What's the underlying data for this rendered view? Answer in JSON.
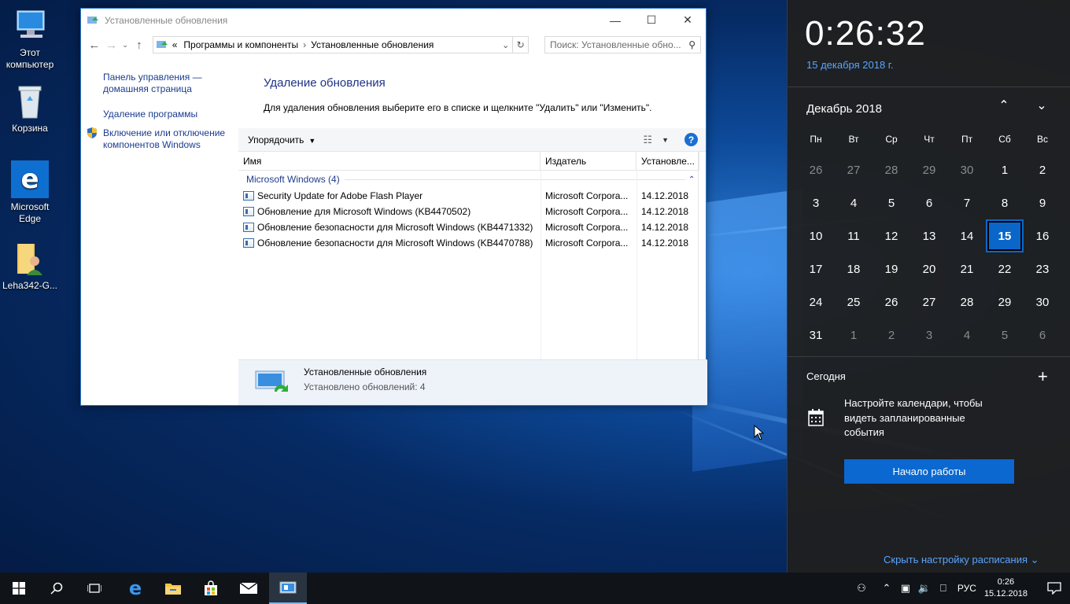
{
  "desktop": {
    "icons": [
      {
        "label": "Этот компьютер",
        "icon": "computer-icon"
      },
      {
        "label": "Корзина",
        "icon": "recycle-bin-icon"
      },
      {
        "label": "Microsoft Edge",
        "icon": "edge-icon"
      },
      {
        "label": "Leha342-G...",
        "icon": "user-folder-icon"
      }
    ]
  },
  "window": {
    "title": "Установленные обновления",
    "address": {
      "prefix": "«",
      "crumb1": "Программы и компоненты",
      "crumb2": "Установленные обновления"
    },
    "search_placeholder": "Поиск: Установленные обно...",
    "left_nav": {
      "home_link": "Панель управления — домашняя страница",
      "uninstall_link": "Удаление программы",
      "features_link": "Включение или отключение компонентов Windows"
    },
    "heading": "Удаление обновления",
    "description": "Для удаления обновления выберите его в списке и щелкните \"Удалить\" или \"Изменить\".",
    "toolbar": {
      "organize": "Упорядочить"
    },
    "columns": {
      "name": "Имя",
      "publisher": "Издатель",
      "installed": "Установле..."
    },
    "group": "Microsoft Windows (4)",
    "rows": [
      {
        "name": "Security Update for Adobe Flash Player",
        "publisher": "Microsoft Corpora...",
        "date": "14.12.2018"
      },
      {
        "name": "Обновление для Microsoft Windows (KB4470502)",
        "publisher": "Microsoft Corpora...",
        "date": "14.12.2018"
      },
      {
        "name": "Обновление безопасности для Microsoft Windows (KB4471332)",
        "publisher": "Microsoft Corpora...",
        "date": "14.12.2018"
      },
      {
        "name": "Обновление безопасности для Microsoft Windows (KB4470788)",
        "publisher": "Microsoft Corpora...",
        "date": "14.12.2018"
      }
    ],
    "details": {
      "title": "Установленные обновления",
      "count": "Установлено обновлений: 4"
    }
  },
  "flyout": {
    "time": "0:26:32",
    "date": "15 декабря 2018 г.",
    "month": "Декабрь 2018",
    "weekdays": [
      "Пн",
      "Вт",
      "Ср",
      "Чт",
      "Пт",
      "Сб",
      "Вс"
    ],
    "weeks": [
      [
        {
          "d": "26",
          "dim": true
        },
        {
          "d": "27",
          "dim": true
        },
        {
          "d": "28",
          "dim": true
        },
        {
          "d": "29",
          "dim": true
        },
        {
          "d": "30",
          "dim": true
        },
        {
          "d": "1"
        },
        {
          "d": "2"
        }
      ],
      [
        {
          "d": "3"
        },
        {
          "d": "4"
        },
        {
          "d": "5"
        },
        {
          "d": "6"
        },
        {
          "d": "7"
        },
        {
          "d": "8"
        },
        {
          "d": "9"
        }
      ],
      [
        {
          "d": "10"
        },
        {
          "d": "11"
        },
        {
          "d": "12"
        },
        {
          "d": "13"
        },
        {
          "d": "14"
        },
        {
          "d": "15",
          "today": true
        },
        {
          "d": "16"
        }
      ],
      [
        {
          "d": "17"
        },
        {
          "d": "18"
        },
        {
          "d": "19"
        },
        {
          "d": "20"
        },
        {
          "d": "21"
        },
        {
          "d": "22"
        },
        {
          "d": "23"
        }
      ],
      [
        {
          "d": "24"
        },
        {
          "d": "25"
        },
        {
          "d": "26"
        },
        {
          "d": "27"
        },
        {
          "d": "28"
        },
        {
          "d": "29"
        },
        {
          "d": "30"
        }
      ],
      [
        {
          "d": "31"
        },
        {
          "d": "1",
          "dim": true
        },
        {
          "d": "2",
          "dim": true
        },
        {
          "d": "3",
          "dim": true
        },
        {
          "d": "4",
          "dim": true
        },
        {
          "d": "5",
          "dim": true
        },
        {
          "d": "6",
          "dim": true
        }
      ]
    ],
    "today_label": "Сегодня",
    "agenda_text": "Настройте календари, чтобы видеть запланированные события",
    "start_button": "Начало работы",
    "hide_link": "Скрыть настройку расписания"
  },
  "taskbar": {
    "lang": "РУС",
    "time": "0:26",
    "date": "15.12.2018"
  },
  "colors": {
    "accent": "#0a67c9",
    "link": "#5aa5ff",
    "nav_link": "#1a3d8f"
  }
}
